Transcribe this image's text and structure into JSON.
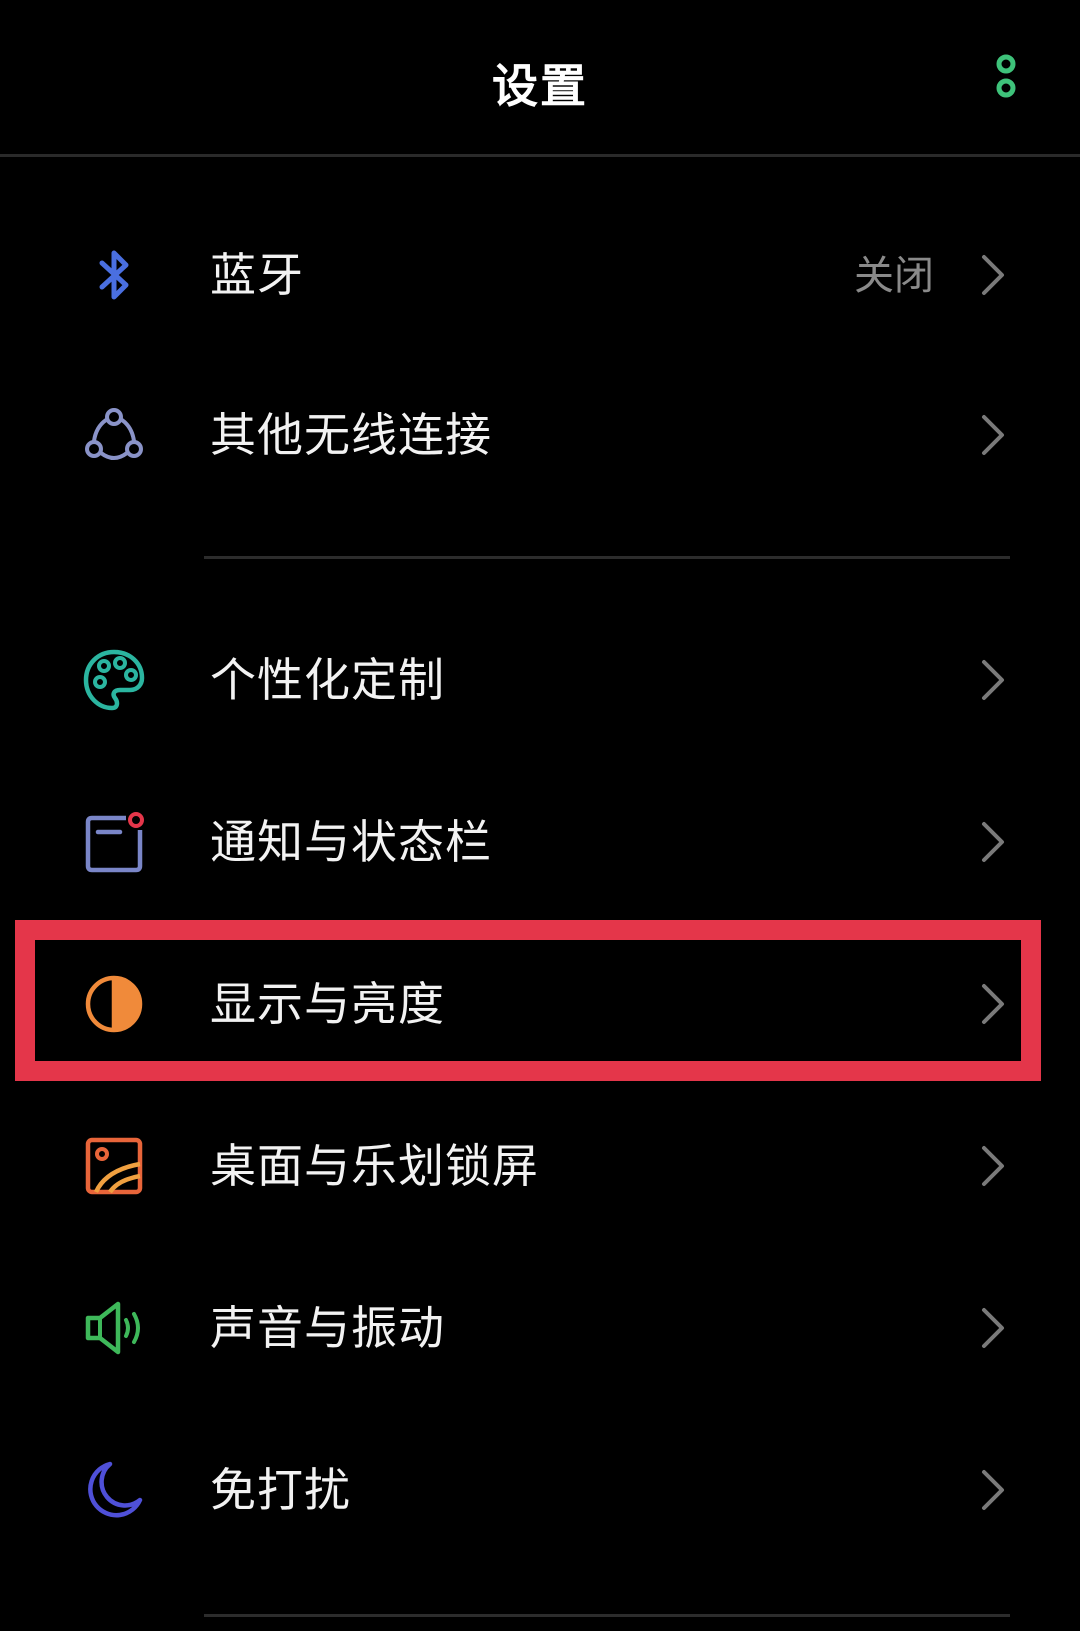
{
  "header": {
    "title": "设置",
    "more_icon": "more-vertical-icon",
    "more_icon_color": "#3ec27a"
  },
  "settings": [
    {
      "label": "蓝牙",
      "status": "关闭",
      "icon": "bluetooth-icon",
      "icon_color": "#4a6fe0"
    },
    {
      "label": "其他无线连接",
      "icon": "connections-icon",
      "icon_color": "#8a93c8"
    },
    {
      "label": "个性化定制",
      "icon": "palette-icon",
      "icon_color": "#2bb5a0"
    },
    {
      "label": "通知与状态栏",
      "icon": "notification-icon",
      "icon_color": "#7a86c8"
    },
    {
      "label": "显示与亮度",
      "icon": "brightness-icon",
      "icon_color": "#f08a3a"
    },
    {
      "label": "桌面与乐划锁屏",
      "icon": "wallpaper-icon",
      "icon_color": "#e8653a"
    },
    {
      "label": "声音与振动",
      "icon": "speaker-icon",
      "icon_color": "#3eb85a"
    },
    {
      "label": "免打扰",
      "icon": "moon-icon",
      "icon_color": "#4f50d8"
    }
  ],
  "colors": {
    "background": "#000000",
    "highlight_border": "#e4364a",
    "chevron": "#7a7a7a",
    "status_text": "#8a8a8a"
  }
}
